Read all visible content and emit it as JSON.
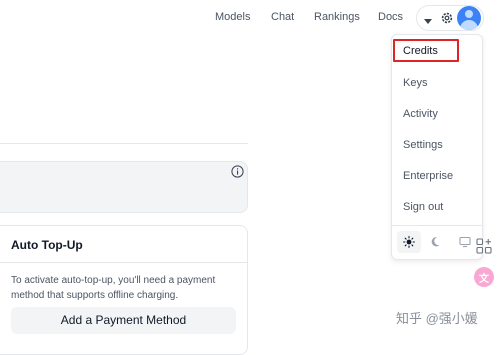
{
  "nav": {
    "links": [
      "Models",
      "Chat",
      "Rankings",
      "Docs"
    ]
  },
  "menu": {
    "items": [
      "Credits",
      "Keys",
      "Activity",
      "Settings",
      "Enterprise",
      "Sign out"
    ],
    "highlighted": "Credits",
    "highlight_color": "#dc2626",
    "theme_options": [
      "light-theme-icon",
      "dark-theme-icon",
      "system-theme-icon"
    ],
    "active_theme": "light"
  },
  "topup": {
    "title": "Auto Top-Up",
    "description": "To activate auto-top-up, you'll need a payment method that supports offline charging.",
    "button": "Add a Payment Method"
  },
  "watermark": {
    "text": "知乎 @强小媛"
  },
  "icons": {
    "caret": "caret-down-icon",
    "gear": "gear-icon",
    "avatar": "avatar",
    "info": "info-icon",
    "grid": "grid-plus-icon",
    "translate": "translate-icon"
  }
}
